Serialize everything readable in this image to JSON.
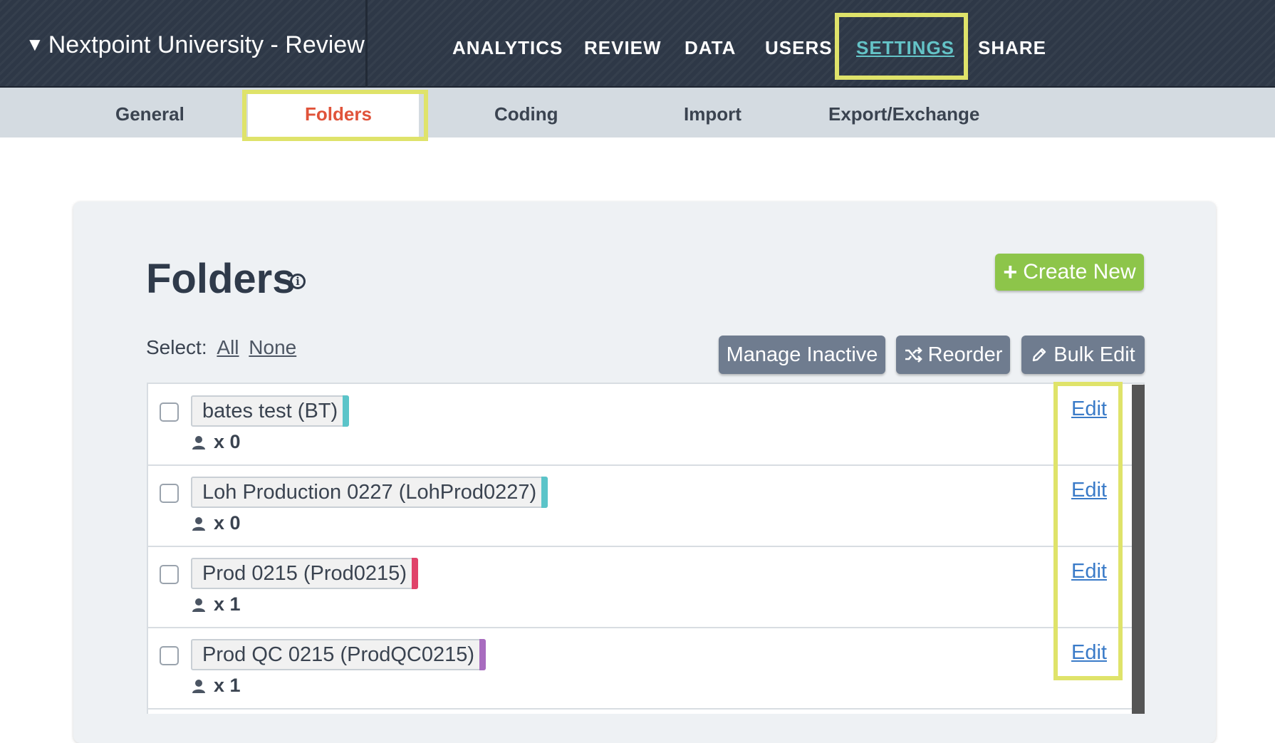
{
  "header": {
    "project": "Nextpoint University - Review",
    "caret": "▼",
    "nav": [
      "ANALYTICS",
      "REVIEW",
      "DATA",
      "USERS",
      "SETTINGS",
      "SHARE"
    ],
    "active_nav": "SETTINGS"
  },
  "subnav": {
    "tabs": [
      "General",
      "Folders",
      "Coding",
      "Import",
      "Export/Exchange"
    ],
    "active_tab": "Folders"
  },
  "main": {
    "title": "Folders",
    "create_label": "Create New",
    "select_label": "Select:",
    "select_all": "All",
    "select_none": "None",
    "manage_inactive_label": "Manage Inactive",
    "reorder_label": "Reorder",
    "bulk_edit_label": "Bulk Edit"
  },
  "folders": [
    {
      "name": "bates test (BT)",
      "count": "x 0",
      "color": "#5bc4c9",
      "edit": "Edit"
    },
    {
      "name": "Loh Production 0227 (LohProd0227)",
      "count": "x 0",
      "color": "#5bc4c9",
      "edit": "Edit"
    },
    {
      "name": "Prod 0215 (Prod0215)",
      "count": "x 1",
      "color": "#e0436a",
      "edit": "Edit"
    },
    {
      "name": "Prod QC 0215 (ProdQC0215)",
      "count": "x 1",
      "color": "#a86cbf",
      "edit": "Edit"
    }
  ],
  "colors": {
    "topbar": "#2e3847",
    "active_nav": "#64c3c7",
    "active_tab": "#e0533a",
    "highlight": "#dfe36a",
    "create_button": "#8dc54a",
    "gray_button": "#6f7c8f",
    "link": "#3a7bc8"
  },
  "icons": [
    "caret-down-icon",
    "info-icon",
    "plus-icon",
    "shuffle-icon",
    "pencil-icon",
    "user-icon"
  ]
}
